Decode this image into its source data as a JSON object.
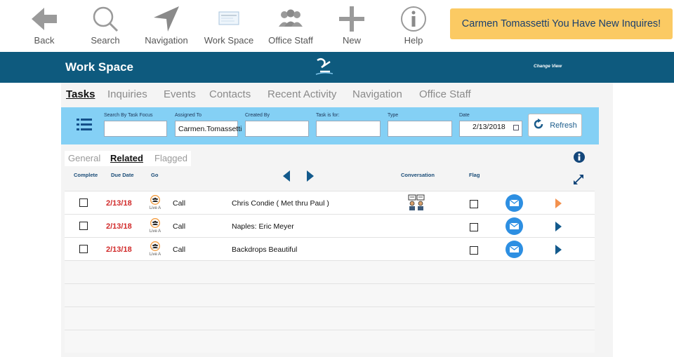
{
  "toolbar": {
    "items": [
      {
        "label": "Back",
        "icon": "back-arrow-icon"
      },
      {
        "label": "Search",
        "icon": "search-icon"
      },
      {
        "label": "Navigation",
        "icon": "navigation-icon"
      },
      {
        "label": "Work Space",
        "icon": "workspace-icon"
      },
      {
        "label": "Office Staff",
        "icon": "office-staff-icon"
      },
      {
        "label": "New",
        "icon": "plus-icon"
      },
      {
        "label": "Help",
        "icon": "info-icon"
      }
    ],
    "notification": "Carmen Tomassetti You Have New Inquires!"
  },
  "banner": {
    "title": "Work Space",
    "change_view": "Change View",
    "color": "#0e5a7e"
  },
  "tabs": [
    "Tasks",
    "Inquiries",
    "Events",
    "Contacts",
    "Recent Activity",
    "Navigation",
    "Office Staff"
  ],
  "active_tab": "Tasks",
  "filters": {
    "search_label": "Search By Task Focus",
    "search_value": "",
    "assigned_label": "Assigned To",
    "assigned_value": "Carmen.Tomassetti",
    "created_label": "Created By",
    "created_value": "",
    "taskfor_label": "Task is for:",
    "taskfor_value": "",
    "type_label": "Type",
    "type_value": "",
    "date_label": "Date",
    "date_value": "2/13/2018",
    "refresh_label": "Refresh"
  },
  "subtabs": [
    "General",
    "Related",
    "Flagged"
  ],
  "active_subtab": "Related",
  "columns": {
    "complete": "Complete",
    "due_date": "Due Date",
    "go": "Go",
    "conversation": "Conversation",
    "flag": "Flag"
  },
  "tasks": [
    {
      "due": "2/13/18",
      "go_label": "Live A",
      "type": "Call",
      "subject": "Chris Condie ( Met thru Paul )",
      "has_conversation": true,
      "arrow_color": "#f3914e"
    },
    {
      "due": "2/13/18",
      "go_label": "Live A",
      "type": "Call",
      "subject": "Naples: Eric Meyer",
      "has_conversation": false,
      "arrow_color": "#135a8c"
    },
    {
      "due": "2/13/18",
      "go_label": "Live A",
      "type": "Call",
      "subject": "Backdrops Beautiful",
      "has_conversation": false,
      "arrow_color": "#135a8c"
    }
  ]
}
